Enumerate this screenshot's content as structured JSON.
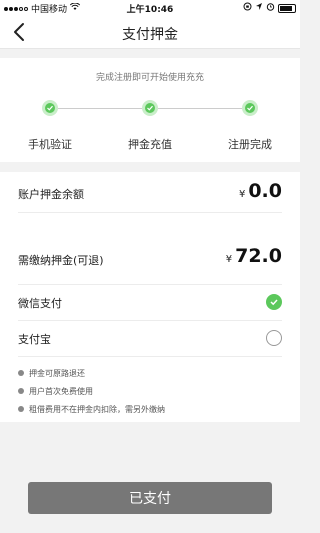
{
  "status_bar": {
    "carrier": "中国移动",
    "time": "上午10:46"
  },
  "nav": {
    "title": "支付押金"
  },
  "steps": {
    "hint": "完成注册即可开始使用充充",
    "items": [
      {
        "label": "手机验证",
        "done": true
      },
      {
        "label": "押金充值",
        "done": true
      },
      {
        "label": "注册完成",
        "done": true
      }
    ]
  },
  "balance": {
    "label": "账户押金余额",
    "currency": "¥",
    "amount": "0.0"
  },
  "due": {
    "label": "需缴纳押金(可退)",
    "currency": "¥",
    "amount": "72.0"
  },
  "payment_methods": [
    {
      "label": "微信支付",
      "selected": true
    },
    {
      "label": "支付宝",
      "selected": false
    }
  ],
  "notes": [
    "押金可原路退还",
    "用户首次免费使用",
    "租借费用不在押金内扣除，需另外缴纳"
  ],
  "pay_button": {
    "label": "已支付"
  },
  "colors": {
    "accent_green": "#5cc85c",
    "button_gray": "#777777"
  }
}
